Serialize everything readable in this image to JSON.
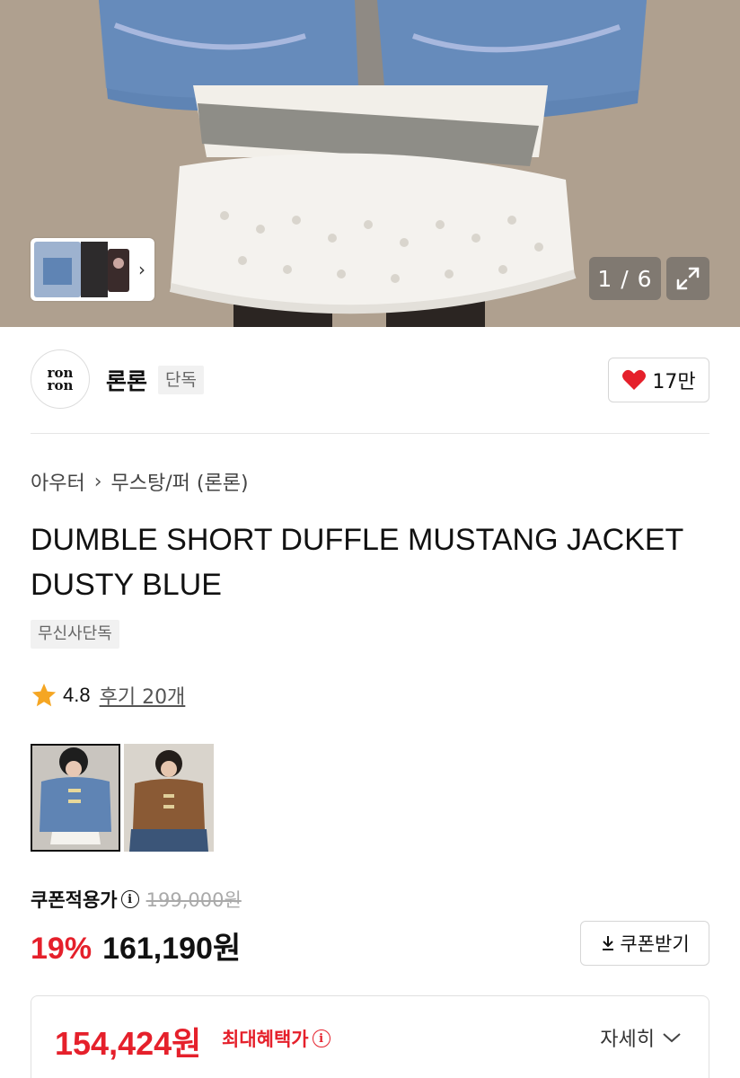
{
  "gallery": {
    "counter": "1 / 6",
    "expand_icon": "expand-arrows-icon",
    "next_icon": "chevron-right-icon"
  },
  "brand": {
    "logo_line1": "ron",
    "logo_line2": "ron",
    "name": "론론",
    "tag": "단독",
    "likes": "17만",
    "like_icon": "heart-icon",
    "like_color": "#e5202b"
  },
  "breadcrumb": {
    "category": "아우터",
    "subcategory": "무스탕/퍼 (론론)"
  },
  "product": {
    "title": "DUMBLE SHORT DUFFLE MUSTANG JACKET DUSTY BLUE",
    "badge": "무신사단독",
    "rating": "4.8",
    "reviews": "후기 20개",
    "star_color": "#f5a623"
  },
  "colors": [
    {
      "name": "dusty-blue",
      "swatch": "#5f84b4",
      "selected": true
    },
    {
      "name": "brown",
      "swatch": "#8a5a35",
      "selected": false
    }
  ],
  "price": {
    "label": "쿠폰적용가",
    "original": "199,000원",
    "discount": "19%",
    "sale": "161,190원",
    "coupon_button": "쿠폰받기"
  },
  "benefit": {
    "price": "154,424원",
    "label": "최대혜택가",
    "detail": "자세히"
  },
  "accent_color": "#e5202b"
}
